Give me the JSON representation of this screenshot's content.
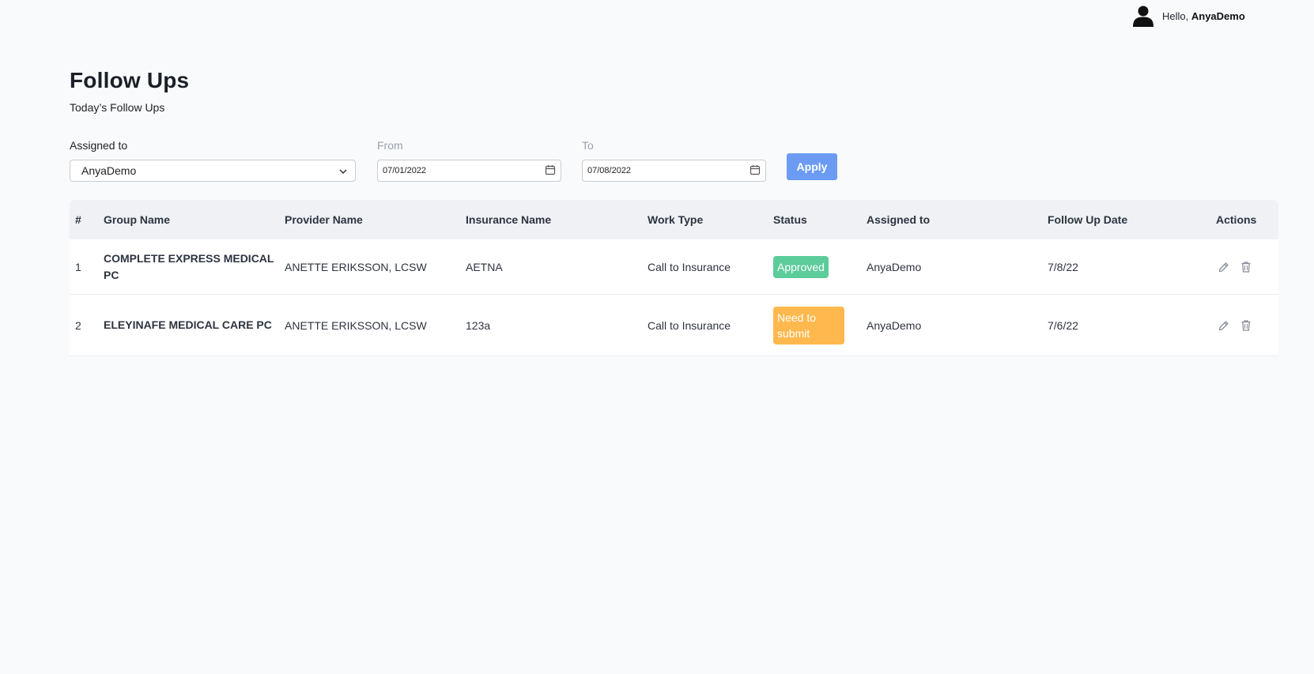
{
  "header": {
    "greeting": "Hello,",
    "username": "AnyaDemo"
  },
  "page": {
    "title": "Follow Ups",
    "subtitle": "Today’s Follow Ups"
  },
  "filters": {
    "assigned_label": "Assigned to",
    "assigned_value": "AnyaDemo",
    "from_label": "From",
    "from_value": "07/01/2022",
    "to_label": "To",
    "to_value": "07/08/2022",
    "apply_label": "Apply"
  },
  "table": {
    "columns": [
      "#",
      "Group Name",
      "Provider Name",
      "Insurance Name",
      "Work Type",
      "Status",
      "Assigned to",
      "Follow Up Date",
      "Actions"
    ],
    "rows": [
      {
        "num": "1",
        "group": "COMPLETE EXPRESS MEDICAL PC",
        "provider": "ANETTE ERIKSSON, LCSW",
        "insurance": "AETNA",
        "work_type": "Call to Insurance",
        "status": "Approved",
        "assigned": "AnyaDemo",
        "date": "7/8/22"
      },
      {
        "num": "2",
        "group": "ELEYINAFE MEDICAL CARE PC",
        "provider": "ANETTE ERIKSSON, LCSW",
        "insurance": "123a",
        "work_type": "Call to Insurance",
        "status": "Need to submit",
        "assigned": "AnyaDemo",
        "date": "7/6/22"
      }
    ]
  },
  "colors": {
    "accent": "#6b9bf3",
    "approved": "#5ccc9b",
    "pending": "#ffb84d"
  },
  "icons": [
    "user-avatar-icon",
    "chevron-down-icon",
    "calendar-icon",
    "edit-icon",
    "trash-icon"
  ]
}
